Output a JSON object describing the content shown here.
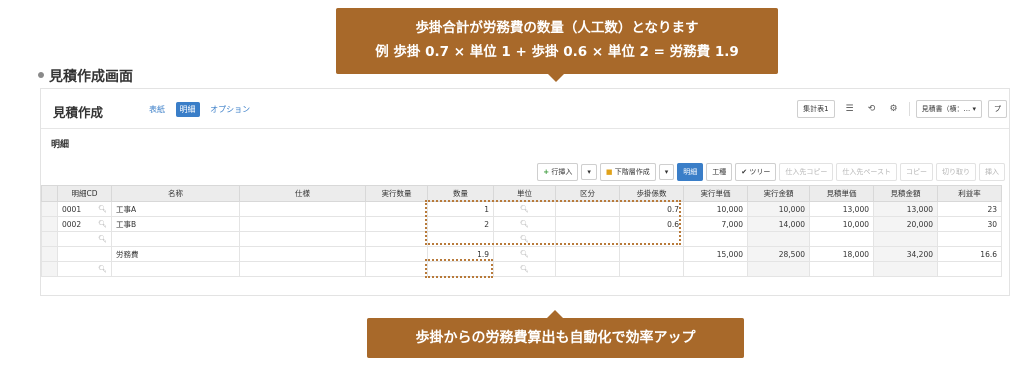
{
  "callouts": {
    "top_line1": "歩掛合計が労務費の数量（人工数）となります",
    "top_line2": "例 歩掛 0.7 × 単位 1 + 歩掛 0.6 × 単位 2 = 労務費 1.9",
    "bottom": "歩掛からの労務費算出も自動化で効率アップ"
  },
  "page_heading": "見積作成画面",
  "app": {
    "title": "見積作成",
    "tabs": [
      {
        "label": "表紙",
        "active": false
      },
      {
        "label": "明細",
        "active": true
      },
      {
        "label": "オプション",
        "active": false
      }
    ],
    "top_right": {
      "summary_button": "集計表1",
      "list_icon": "list-icon",
      "history_icon": "history-icon",
      "settings_icon": "gear-icon",
      "doc_select": "見積書（横：...",
      "more_label": "プ"
    },
    "section_title": "明細",
    "toolbar": {
      "insert_row": "行挿入",
      "create_sublevel": "下階層作成",
      "detail": "明細",
      "work": "工種",
      "tree": "ツリー",
      "copy_dest": "仕入先コピー",
      "paste_dest": "仕入先ペースト",
      "copy": "コピー",
      "cut": "切り取り",
      "insert": "挿入"
    }
  },
  "table": {
    "columns": [
      "明細CD",
      "名称",
      "仕様",
      "実行数量",
      "数量",
      "単位",
      "区分",
      "歩掛係数",
      "実行単価",
      "実行金額",
      "見積単価",
      "見積金額",
      "利益率"
    ],
    "rows": [
      {
        "cd": "0001",
        "name": "工事A",
        "spec": "",
        "exec_qty": "",
        "qty": "1",
        "unit": "",
        "kubun": "",
        "coef": "0.7",
        "exec_price": "10,000",
        "exec_amount": "10,000",
        "est_price": "13,000",
        "est_amount": "13,000",
        "margin": "23"
      },
      {
        "cd": "0002",
        "name": "工事B",
        "spec": "",
        "exec_qty": "",
        "qty": "2",
        "unit": "",
        "kubun": "",
        "coef": "0.6",
        "exec_price": "7,000",
        "exec_amount": "14,000",
        "est_price": "10,000",
        "est_amount": "20,000",
        "margin": "30"
      },
      {
        "cd": "",
        "name": "",
        "spec": "",
        "exec_qty": "",
        "qty": "",
        "unit": "",
        "kubun": "",
        "coef": "",
        "exec_price": "",
        "exec_amount": "",
        "est_price": "",
        "est_amount": "",
        "margin": ""
      },
      {
        "cd": "",
        "name": "労務費",
        "spec": "",
        "exec_qty": "",
        "qty": "1.9",
        "unit": "",
        "kubun": "",
        "coef": "",
        "exec_price": "15,000",
        "exec_amount": "28,500",
        "est_price": "18,000",
        "est_amount": "34,200",
        "margin": "16.6"
      },
      {
        "cd": "",
        "name": "",
        "spec": "",
        "exec_qty": "",
        "qty": "",
        "unit": "",
        "kubun": "",
        "coef": "",
        "exec_price": "",
        "exec_amount": "",
        "est_price": "",
        "est_amount": "",
        "margin": ""
      }
    ]
  },
  "colors": {
    "callout_bg": "#a8692a",
    "accent_blue": "#3a7ec8",
    "dotted_highlight": "#b87a3a"
  }
}
